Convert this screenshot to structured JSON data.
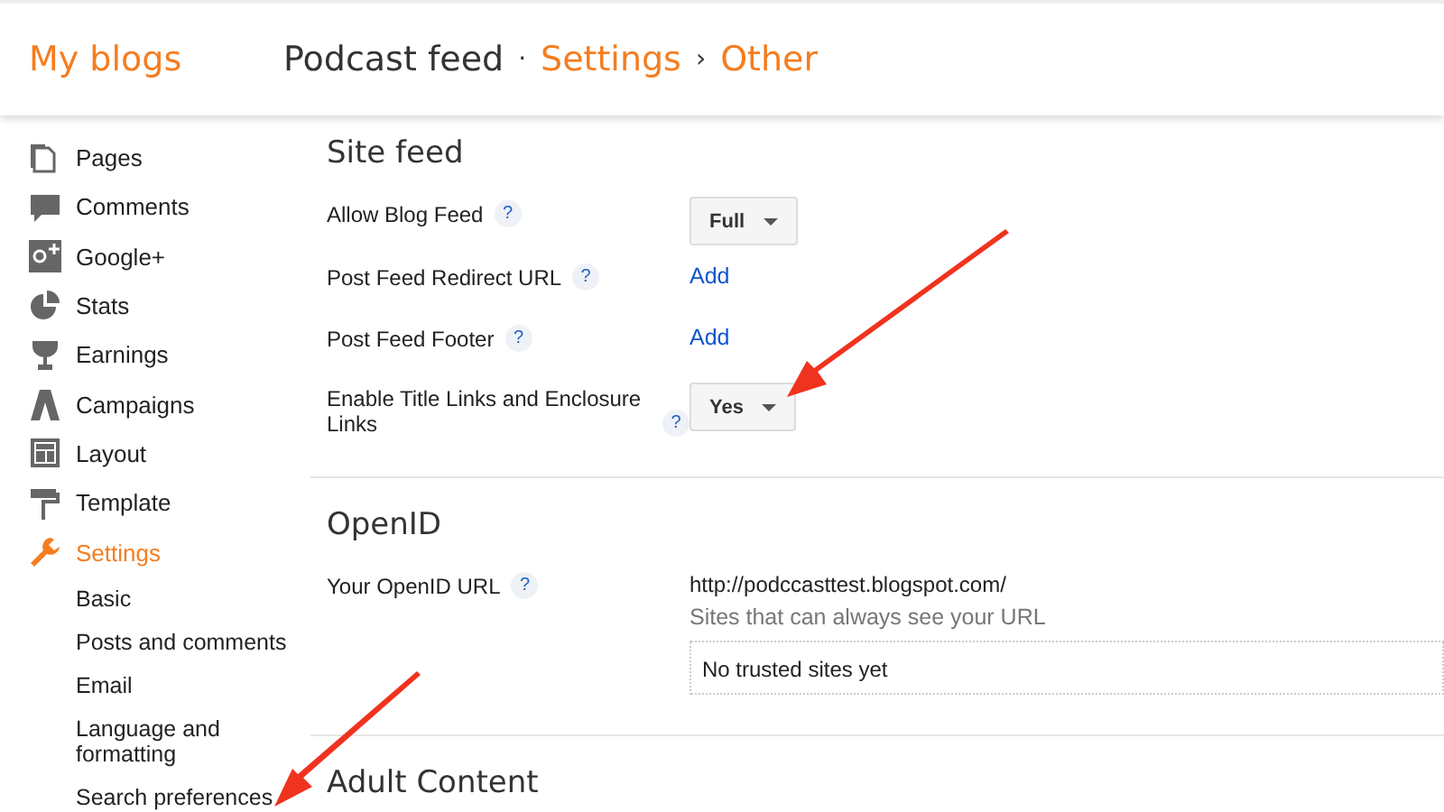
{
  "header": {
    "home": "My blogs",
    "blog": "Podcast feed",
    "separator": "·",
    "section": "Settings",
    "arrow": "›",
    "page": "Other"
  },
  "sidebar": {
    "items": [
      {
        "label": "Pages",
        "selected": false
      },
      {
        "label": "Comments",
        "selected": false
      },
      {
        "label": "Google+",
        "selected": false
      },
      {
        "label": "Stats",
        "selected": false
      },
      {
        "label": "Earnings",
        "selected": false
      },
      {
        "label": "Campaigns",
        "selected": false
      },
      {
        "label": "Layout",
        "selected": false
      },
      {
        "label": "Template",
        "selected": false
      },
      {
        "label": "Settings",
        "selected": true
      }
    ],
    "subitems": [
      "Basic",
      "Posts and comments",
      "Email",
      "Language and formatting",
      "Search preferences"
    ]
  },
  "sections": [
    {
      "title": "Site feed",
      "rows": [
        {
          "label": "Allow Blog Feed",
          "help": "?",
          "kind": "dropdown",
          "value": "Full"
        },
        {
          "label": "Post Feed Redirect URL",
          "help": "?",
          "kind": "link",
          "value": "Add"
        },
        {
          "label": "Post Feed Footer",
          "help": "?",
          "kind": "link",
          "value": "Add"
        },
        {
          "label": "Enable Title Links and Enclosure Links",
          "help": "?",
          "kind": "dropdown",
          "value": "Yes"
        }
      ]
    },
    {
      "title": "OpenID",
      "rows": [
        {
          "label": "Your OpenID URL",
          "help": "?",
          "kind": "openid",
          "value": "http://podccasttest.blogspot.com/",
          "note": "Sites that can always see your URL",
          "list_text": "No trusted sites yet"
        }
      ]
    },
    {
      "title": "Adult Content"
    }
  ]
}
